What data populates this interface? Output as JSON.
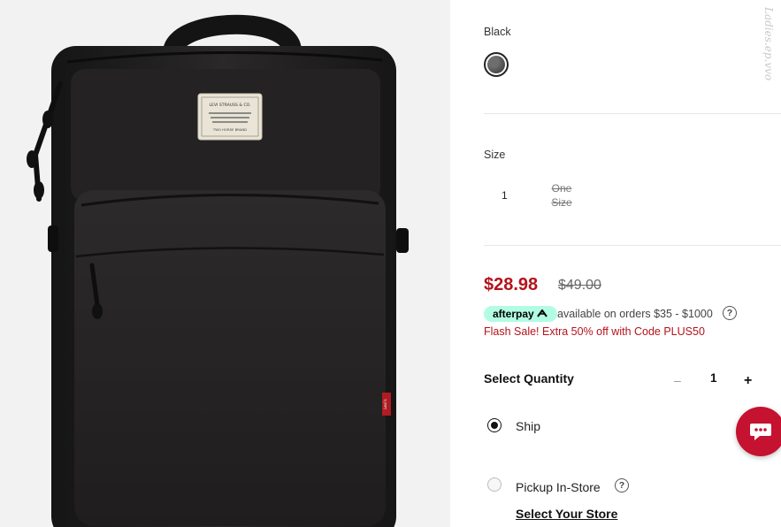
{
  "product_image": {
    "alt": "black backpack",
    "patch_text": [
      "LEVI STRAUSS & CO.",
      "TWO HORSE BRAND"
    ],
    "side_tab_text": "Levi's"
  },
  "color": {
    "label": "Black",
    "swatch_color": "#5a5a5a"
  },
  "size": {
    "label": "Size",
    "options": [
      {
        "label": "1",
        "available": true
      },
      {
        "label_line1": "One",
        "label_line2": "Size",
        "available": false
      }
    ]
  },
  "price": {
    "sale": "$28.98",
    "original": "$49.00",
    "sale_color": "#b5121b"
  },
  "afterpay": {
    "badge_label": "afterpay",
    "text": "available on orders $35 - $1000",
    "badge_color": "#b2fce4"
  },
  "promo": {
    "text": "Flash Sale! Extra 50% off with Code PLUS50"
  },
  "quantity": {
    "label": "Select Quantity",
    "minus": "–",
    "value": "1",
    "plus": "+"
  },
  "fulfillment": {
    "ship_label": "Ship",
    "ship_selected": true,
    "pickup_label": "Pickup In-Store",
    "select_store_label": "Select Your Store"
  },
  "help_glyph": "?",
  "chat": {
    "icon": "chat-icon",
    "color": "#c41230"
  },
  "watermark": "Ladies.ep.vvo"
}
